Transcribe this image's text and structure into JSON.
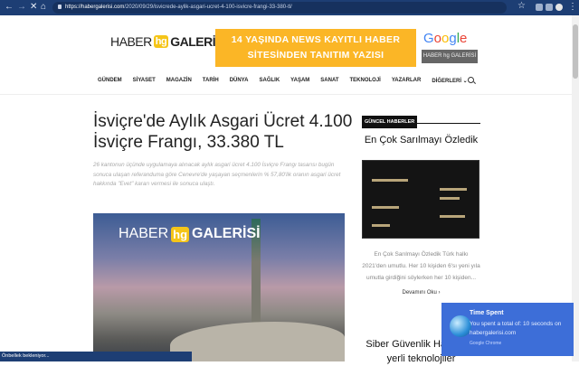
{
  "browser": {
    "url_host": "https://habergalerisi.com",
    "url_path": "/2020/09/29/isvicrede-aylik-asgari-ucret-4-100-isvicre-frangi-33-380-tl/",
    "back_icon": "←",
    "forward_icon": "→",
    "stop_icon": "✕",
    "home_icon": "⌂",
    "menu_icon": "⋮",
    "star_icon": "☆"
  },
  "site": {
    "logo_left": "HABER",
    "logo_mark": "hg",
    "logo_right": "GALERİSİ",
    "banner_line1": "14 YAŞINDA NEWS KAYITLI HABER",
    "banner_line2": "SİTESİNDEN TANITIM YAZISI",
    "google_badge": "HABER hg GALERİSİ",
    "google_letters": [
      {
        "ch": "G",
        "color": "#4285f4"
      },
      {
        "ch": "o",
        "color": "#ea4335"
      },
      {
        "ch": "o",
        "color": "#fbbc05"
      },
      {
        "ch": "g",
        "color": "#4285f4"
      },
      {
        "ch": "l",
        "color": "#34a853"
      },
      {
        "ch": "e",
        "color": "#ea4335"
      }
    ],
    "accent": "#fbb626"
  },
  "menu": [
    "GÜNDEM",
    "SİYASET",
    "MAGAZİN",
    "TARİH",
    "DÜNYA",
    "SAĞLIK",
    "YAŞAM",
    "SANAT",
    "TEKNOLOJİ",
    "YAZARLAR",
    "DİĞERLERİ ⌄"
  ],
  "article": {
    "title": "İsviçre'de Aylık Asgari Ücret 4.100 İsviçre Frangı, 33.380 TL",
    "summary": "26 kantonun üçünde uygulamaya alınacak aylık asgari ücret 4.100 İsviçre Frangı tasarısı bugün sonuca ulaşan referanduma göre Cenevre'de yaşayan seçmenlerin % 57,80'lik oranın asgari ücret hakkında \"Evet\" kararı vermesi ile sonuca ulaştı.",
    "image_logo_left": "HABER",
    "image_logo_mark": "hg",
    "image_logo_right": "GALERİSİ"
  },
  "sidebar": {
    "header": "GÜNCEL HABERLER",
    "post1_title": "En Çok Sarılmayı Özledik",
    "post1_excerpt": "En Çok Sarılmayı Özledik Türk halkı 2021'den umutlu. Her 10 kişiden 6'sı yeni yıla umutla girdiğini söylerken her 10 kişiden...",
    "read_more": "Devamını Oku ›",
    "post2_title": "Siber Güvenlik Haberleri: yerli teknolojiler"
  },
  "notification": {
    "title": "Time Spent",
    "body": "You spent a total of: 10 seconds on habergalerisi.com",
    "source": "Google Chrome"
  },
  "status_bar": "Önbellek bekleniyor..."
}
